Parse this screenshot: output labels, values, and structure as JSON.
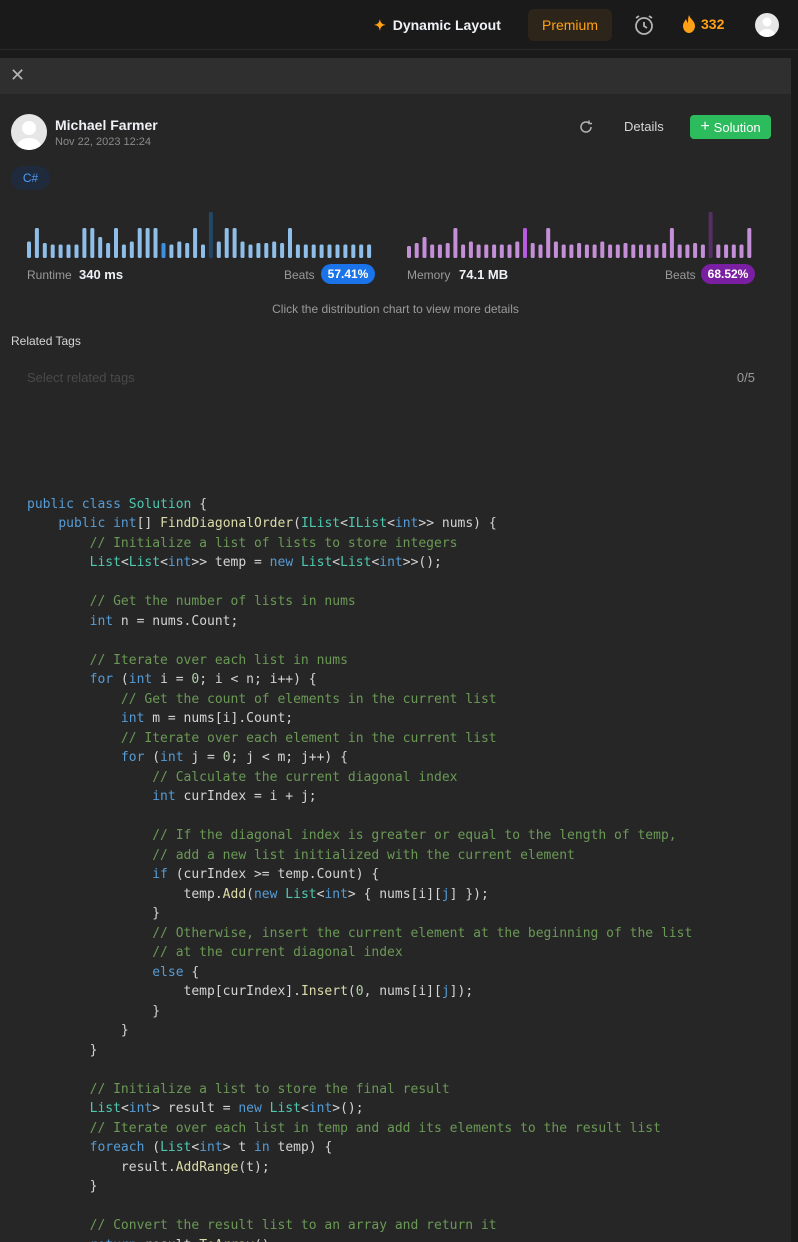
{
  "topbar": {
    "dynamic_layout": "Dynamic Layout",
    "premium": "Premium",
    "streak": "332"
  },
  "submission": {
    "author": "Michael Farmer",
    "date": "Nov 22, 2023 12:24",
    "details_label": "Details",
    "solution_label": "Solution",
    "language": "C#"
  },
  "runtime": {
    "label": "Runtime",
    "value": "340 ms",
    "beats_label": "Beats",
    "beats": "57.41%",
    "distribution": [
      0.55,
      1,
      0.5,
      0.45,
      0.45,
      0.45,
      0.45,
      1,
      1,
      0.7,
      0.5,
      1,
      0.45,
      0.55,
      1,
      1,
      1,
      0.5,
      0.45,
      0.55,
      0.5,
      1,
      0.45,
      1,
      0.55,
      1,
      1,
      0.55,
      0.45,
      0.5,
      0.5,
      0.55,
      0.5,
      1,
      0.45,
      0.45,
      0.45,
      0.45,
      0.45,
      0.45,
      0.45,
      0.45,
      0.45,
      0.45
    ],
    "highlight_index": 17,
    "dim_index": 23
  },
  "memory": {
    "label": "Memory",
    "value": "74.1 MB",
    "beats_label": "Beats",
    "beats": "68.52%",
    "distribution": [
      0.4,
      0.5,
      0.7,
      0.45,
      0.45,
      0.5,
      1,
      0.45,
      0.55,
      0.45,
      0.45,
      0.45,
      0.45,
      0.45,
      0.55,
      1,
      0.5,
      0.45,
      1,
      0.55,
      0.45,
      0.45,
      0.5,
      0.45,
      0.45,
      0.55,
      0.45,
      0.45,
      0.5,
      0.45,
      0.45,
      0.45,
      0.45,
      0.5,
      1,
      0.45,
      0.45,
      0.5,
      0.45,
      1,
      0.45,
      0.45,
      0.45,
      0.45,
      1
    ],
    "highlight_index": 15,
    "dim_index": 39
  },
  "hint": "Click the distribution chart to view more details",
  "related_tags": {
    "title": "Related Tags",
    "placeholder": "Select related tags",
    "count": "0/5"
  },
  "code_lines": [
    "",
    "",
    "",
    [
      [
        "k",
        "public "
      ],
      [
        "k",
        "class "
      ],
      [
        "t",
        "Solution"
      ],
      [
        "p",
        " {"
      ]
    ],
    [
      [
        "p",
        "    "
      ],
      [
        "k",
        "public "
      ],
      [
        "k",
        "int"
      ],
      [
        "p",
        "[] "
      ],
      [
        "f",
        "FindDiagonalOrder"
      ],
      [
        "p",
        "("
      ],
      [
        "t",
        "IList"
      ],
      [
        "p",
        "<"
      ],
      [
        "t",
        "IList"
      ],
      [
        "p",
        "<"
      ],
      [
        "k",
        "int"
      ],
      [
        "p",
        ">> nums) {"
      ]
    ],
    [
      [
        "c",
        "        // Initialize a list of lists to store integers"
      ]
    ],
    [
      [
        "p",
        "        "
      ],
      [
        "t",
        "List"
      ],
      [
        "p",
        "<"
      ],
      [
        "t",
        "List"
      ],
      [
        "p",
        "<"
      ],
      [
        "k",
        "int"
      ],
      [
        "p",
        ">> temp = "
      ],
      [
        "k",
        "new "
      ],
      [
        "t",
        "List"
      ],
      [
        "p",
        "<"
      ],
      [
        "t",
        "List"
      ],
      [
        "p",
        "<"
      ],
      [
        "k",
        "int"
      ],
      [
        "p",
        ">>();"
      ]
    ],
    "",
    [
      [
        "c",
        "        // Get the number of lists in nums"
      ]
    ],
    [
      [
        "p",
        "        "
      ],
      [
        "k",
        "int"
      ],
      [
        "p",
        " n = nums.Count;"
      ]
    ],
    "",
    [
      [
        "c",
        "        // Iterate over each list in nums"
      ]
    ],
    [
      [
        "p",
        "        "
      ],
      [
        "k",
        "for"
      ],
      [
        "p",
        " ("
      ],
      [
        "k",
        "int"
      ],
      [
        "p",
        " i = "
      ],
      [
        "n",
        "0"
      ],
      [
        "p",
        "; i < n; i++) {"
      ]
    ],
    [
      [
        "c",
        "            // Get the count of elements in the current list"
      ]
    ],
    [
      [
        "p",
        "            "
      ],
      [
        "k",
        "int"
      ],
      [
        "p",
        " m = nums[i].Count;"
      ]
    ],
    [
      [
        "c",
        "            // Iterate over each element in the current list"
      ]
    ],
    [
      [
        "p",
        "            "
      ],
      [
        "k",
        "for"
      ],
      [
        "p",
        " ("
      ],
      [
        "k",
        "int"
      ],
      [
        "p",
        " j = "
      ],
      [
        "n",
        "0"
      ],
      [
        "p",
        "; j < m; j++) {"
      ]
    ],
    [
      [
        "c",
        "                // Calculate the current diagonal index"
      ]
    ],
    [
      [
        "p",
        "                "
      ],
      [
        "k",
        "int"
      ],
      [
        "p",
        " curIndex = i + j;"
      ]
    ],
    "",
    [
      [
        "c",
        "                // If the diagonal index is greater or equal to the length of temp,"
      ]
    ],
    [
      [
        "c",
        "                // add a new list initialized with the current element"
      ]
    ],
    [
      [
        "p",
        "                "
      ],
      [
        "k",
        "if"
      ],
      [
        "p",
        " (curIndex >= temp.Count) {"
      ]
    ],
    [
      [
        "p",
        "                    temp."
      ],
      [
        "f",
        "Add"
      ],
      [
        "p",
        "("
      ],
      [
        "k",
        "new "
      ],
      [
        "t",
        "List"
      ],
      [
        "p",
        "<"
      ],
      [
        "k",
        "int"
      ],
      [
        "p",
        "> { nums[i]["
      ],
      [
        "k",
        "j"
      ],
      [
        "p",
        "] });"
      ]
    ],
    [
      [
        "p",
        "                }"
      ]
    ],
    [
      [
        "c",
        "                // Otherwise, insert the current element at the beginning of the list"
      ]
    ],
    [
      [
        "c",
        "                // at the current diagonal index"
      ]
    ],
    [
      [
        "p",
        "                "
      ],
      [
        "k",
        "else"
      ],
      [
        "p",
        " {"
      ]
    ],
    [
      [
        "p",
        "                    temp[curIndex]."
      ],
      [
        "f",
        "Insert"
      ],
      [
        "p",
        "("
      ],
      [
        "n",
        "0"
      ],
      [
        "p",
        ", nums[i]["
      ],
      [
        "k",
        "j"
      ],
      [
        "p",
        "]);"
      ]
    ],
    [
      [
        "p",
        "                }"
      ]
    ],
    [
      [
        "p",
        "            }"
      ]
    ],
    [
      [
        "p",
        "        }"
      ]
    ],
    "",
    [
      [
        "c",
        "        // Initialize a list to store the final result"
      ]
    ],
    [
      [
        "p",
        "        "
      ],
      [
        "t",
        "List"
      ],
      [
        "p",
        "<"
      ],
      [
        "k",
        "int"
      ],
      [
        "p",
        "> result = "
      ],
      [
        "k",
        "new "
      ],
      [
        "t",
        "List"
      ],
      [
        "p",
        "<"
      ],
      [
        "k",
        "int"
      ],
      [
        "p",
        ">();"
      ]
    ],
    [
      [
        "c",
        "        // Iterate over each list in temp and add its elements to the result list"
      ]
    ],
    [
      [
        "p",
        "        "
      ],
      [
        "k",
        "foreach"
      ],
      [
        "p",
        " ("
      ],
      [
        "t",
        "List"
      ],
      [
        "p",
        "<"
      ],
      [
        "k",
        "int"
      ],
      [
        "p",
        "> t "
      ],
      [
        "k",
        "in"
      ],
      [
        "p",
        " temp) {"
      ]
    ],
    [
      [
        "p",
        "            result."
      ],
      [
        "f",
        "AddRange"
      ],
      [
        "p",
        "(t);"
      ]
    ],
    [
      [
        "p",
        "        }"
      ]
    ],
    "",
    [
      [
        "c",
        "        // Convert the result list to an array and return it"
      ]
    ],
    [
      [
        "p",
        "        "
      ],
      [
        "k",
        "return"
      ],
      [
        "p",
        " result."
      ],
      [
        "f",
        "ToArray"
      ],
      [
        "p",
        "();"
      ]
    ],
    [
      [
        "p",
        "    }"
      ]
    ],
    [
      [
        "p",
        "}"
      ]
    ]
  ]
}
